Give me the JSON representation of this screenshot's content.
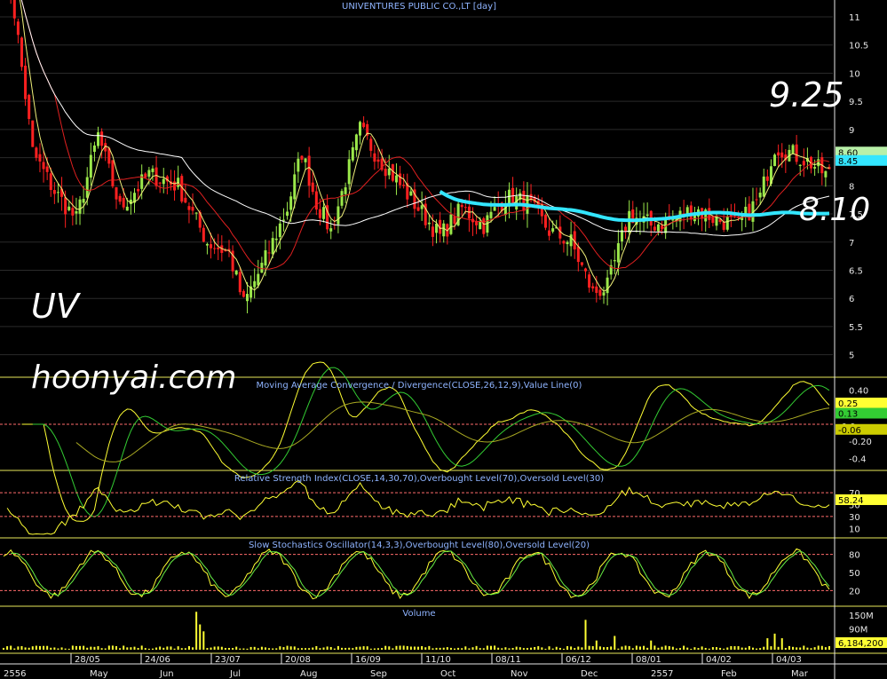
{
  "chart_data": {
    "type": "candlestick",
    "title": "UNIVENTURES PUBLIC CO.,LT [day]",
    "watermark_symbol": "UV",
    "watermark_site": "hoonyai.com",
    "annotations": [
      {
        "text": "9.25",
        "value": 9.25
      },
      {
        "text": "8.10",
        "value": 8.1
      }
    ],
    "price_axis": {
      "ticks": [
        "11",
        "10.5",
        "10",
        "9.5",
        "9",
        "8.5",
        "8",
        "7.5",
        "7",
        "6.5",
        "6",
        "5.5",
        "5"
      ],
      "ylim": [
        4.6,
        11.3
      ]
    },
    "price_tags": [
      {
        "text": "8.60",
        "value": 8.6,
        "color": "#b8f0a8"
      },
      {
        "text": "8.45",
        "value": 8.45,
        "color": "#33e6ff"
      }
    ],
    "date_labels_top": [
      "28/05",
      "24/06",
      "23/07",
      "20/08",
      "16/09",
      "11/10",
      "08/11",
      "06/12",
      "08/01",
      "04/02",
      "04/03"
    ],
    "date_labels_bottom": [
      "2556",
      "May",
      "Jun",
      "Jul",
      "Aug",
      "Sep",
      "Oct",
      "Nov",
      "Dec",
      "2557",
      "Feb",
      "Mar"
    ],
    "price_series": {
      "close_keypoints": [
        [
          0,
          12.5
        ],
        [
          4,
          10.6
        ],
        [
          8,
          8.6
        ],
        [
          14,
          7.9
        ],
        [
          20,
          7.4
        ],
        [
          26,
          8.9
        ],
        [
          32,
          7.6
        ],
        [
          40,
          8.2
        ],
        [
          48,
          8.0
        ],
        [
          56,
          7.0
        ],
        [
          62,
          6.8
        ],
        [
          66,
          5.9
        ],
        [
          72,
          6.7
        ],
        [
          78,
          7.6
        ],
        [
          82,
          8.6
        ],
        [
          86,
          7.7
        ],
        [
          90,
          7.2
        ],
        [
          94,
          8.1
        ],
        [
          98,
          9.0
        ],
        [
          102,
          8.6
        ],
        [
          108,
          8.1
        ],
        [
          114,
          7.6
        ],
        [
          120,
          7.1
        ],
        [
          126,
          7.6
        ],
        [
          132,
          7.3
        ],
        [
          138,
          7.8
        ],
        [
          144,
          7.7
        ],
        [
          150,
          7.2
        ],
        [
          156,
          7.0
        ],
        [
          162,
          6.1
        ],
        [
          166,
          6.2
        ],
        [
          172,
          7.5
        ],
        [
          178,
          7.3
        ],
        [
          184,
          7.4
        ],
        [
          190,
          7.6
        ],
        [
          196,
          7.4
        ],
        [
          202,
          7.3
        ],
        [
          208,
          7.8
        ],
        [
          212,
          8.7
        ],
        [
          216,
          8.6
        ],
        [
          222,
          8.4
        ],
        [
          226,
          8.2
        ]
      ],
      "ma_fast": "#f0f07a",
      "ma_mid": "#e02020",
      "ma_slow": "#ffffff",
      "ma_long": "#33e6ff"
    },
    "macd": {
      "title": "Moving Average Convergence / Divergence(CLOSE,26,12,9),Value Line(0)",
      "ticks": [
        "0.40",
        "0.20",
        "0.0",
        "-0.20",
        "-0.4"
      ],
      "ylim": [
        -0.5,
        0.5
      ],
      "last_tags": [
        {
          "text": "0.25",
          "value": 0.25,
          "color": "#ffff33"
        },
        {
          "text": "0.13",
          "value": 0.13,
          "color": "#33cc33"
        },
        {
          "text": "-0.0",
          "value": -0.02,
          "color": "#000000"
        },
        {
          "text": "-0.06",
          "value": -0.06,
          "color": "#cccc00"
        }
      ]
    },
    "rsi": {
      "title": "Relative Strength Index(CLOSE,14,30,70),Overbought Level(70),Oversold Level(30)",
      "ticks": [
        "70",
        "50",
        "30",
        "10"
      ],
      "levels": [
        70,
        30
      ],
      "last_tag": "58.24",
      "ylim": [
        0,
        100
      ]
    },
    "stochastic": {
      "title": "Slow Stochastics Oscillator(14,3,3),Overbought Level(80),Oversold Level(20)",
      "ticks": [
        "80",
        "50",
        "20"
      ],
      "levels": [
        80,
        20
      ],
      "ylim": [
        0,
        100
      ]
    },
    "volume": {
      "title": "Volume",
      "ticks": [
        "150M",
        "90M",
        "30M"
      ],
      "last_tag": "6,184,200",
      "ylim": [
        0,
        170
      ],
      "spikes": [
        [
          53,
          165
        ],
        [
          54,
          110
        ],
        [
          55,
          80
        ],
        [
          160,
          130
        ],
        [
          163,
          40
        ],
        [
          168,
          60
        ],
        [
          178,
          40
        ],
        [
          210,
          50
        ],
        [
          212,
          70
        ],
        [
          214,
          50
        ]
      ]
    },
    "colors": {
      "up": "#9be84a",
      "down": "#ff2020",
      "frame": "#e8e85a",
      "level": "#ff6b6b",
      "grid": "#2a2a2a"
    }
  }
}
